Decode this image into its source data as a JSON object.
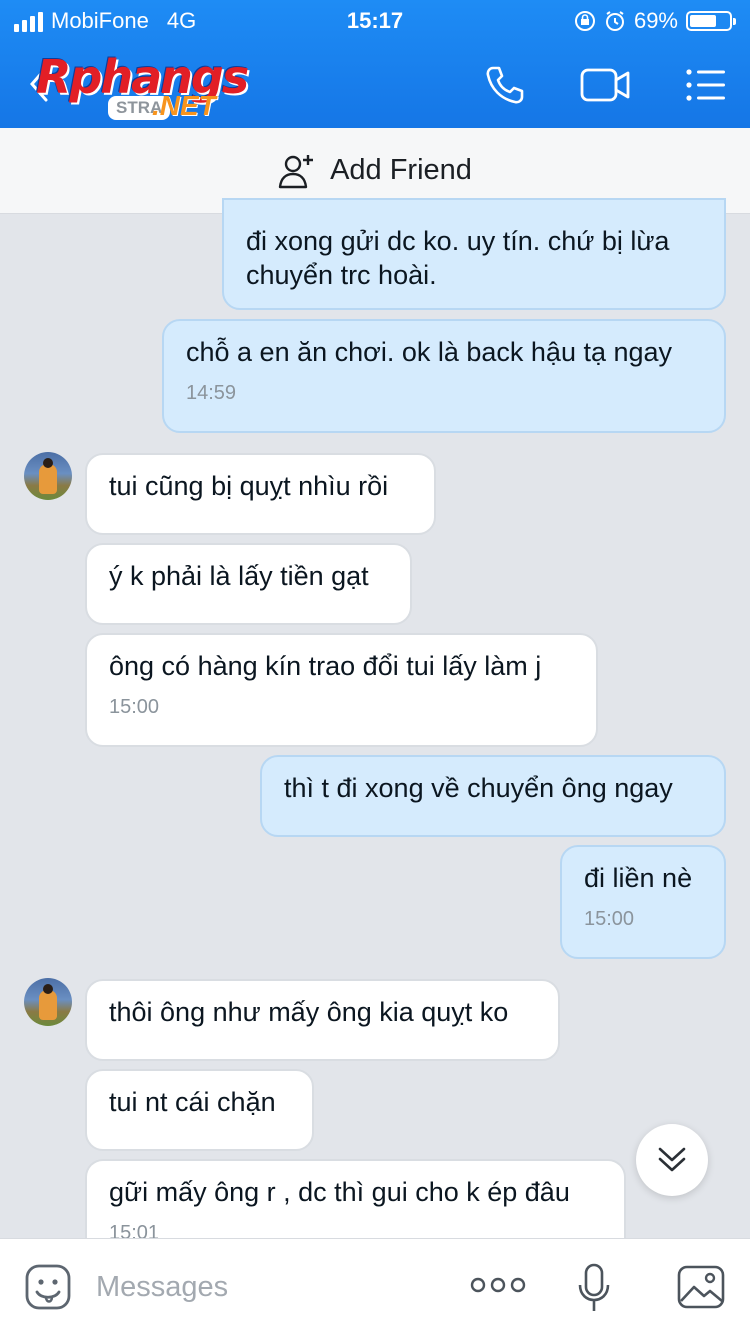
{
  "status_bar": {
    "carrier": "MobiFone",
    "network": "4G",
    "time": "15:17",
    "battery": "69%",
    "battery_level": 0.69
  },
  "header": {
    "logo_text": "Rphangs",
    "logo_sub": "STRA",
    "logo_domain": ".NET"
  },
  "add_friend": {
    "label": "Add Friend"
  },
  "messages": [
    {
      "from": "me",
      "text": "đi xong gửi dc ko. uy tín. chứ bị lừa chuyển trc hoài.",
      "time": ""
    },
    {
      "from": "me",
      "text": "chỗ a en ăn chơi. ok là back hậu tạ ngay",
      "time": "14:59"
    },
    {
      "from": "them",
      "text": "tui cũng bị quỵt nhìu rồi",
      "time": ""
    },
    {
      "from": "them",
      "text": "ý k phải là lấy tiền gạt",
      "time": ""
    },
    {
      "from": "them",
      "text": "ông có hàng kín trao đổi tui lấy làm j",
      "time": "15:00"
    },
    {
      "from": "me",
      "text": "thì t đi xong về chuyển ông ngay",
      "time": ""
    },
    {
      "from": "me",
      "text": "đi liền nè",
      "time": "15:00"
    },
    {
      "from": "them",
      "text": "thôi ông như mấy ông kia quỵt ko",
      "time": ""
    },
    {
      "from": "them",
      "text": "tui nt cái chặn",
      "time": ""
    },
    {
      "from": "them",
      "text": "gữi mấy ông r , dc thì gui cho k ép đâu",
      "time": "15:01"
    }
  ],
  "input": {
    "placeholder": "Messages"
  },
  "colors": {
    "header_blue": "#1a82ef",
    "my_bubble": "#d5ebfd",
    "their_bubble": "#ffffff",
    "chat_bg": "#e2e5ea"
  }
}
